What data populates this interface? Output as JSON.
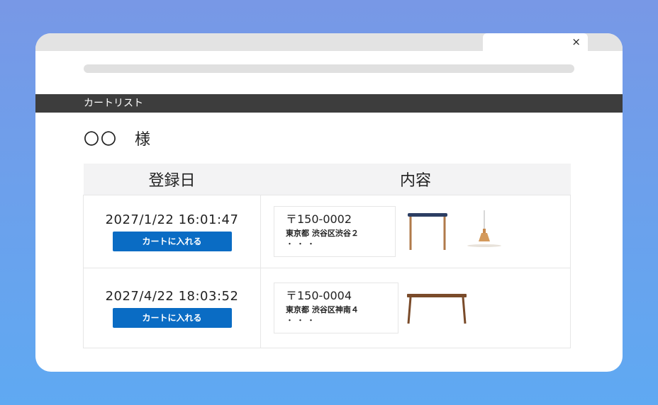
{
  "browser": {
    "tab_close": "×"
  },
  "page": {
    "section_title": "カートリスト",
    "customer_name": "〇〇　様"
  },
  "table": {
    "headers": [
      "登録日",
      "内容"
    ],
    "rows": [
      {
        "date": "2027/1/22 16:01:47",
        "button_label": "カートに入れる",
        "zip": "〒150-0002",
        "address": "東京都 渋谷区渋谷２",
        "ellipsis": "・・・",
        "products": [
          "stool-icon",
          "pendant-lamp-icon"
        ]
      },
      {
        "date": "2027/4/22 18:03:52",
        "button_label": "カートに入れる",
        "zip": "〒150-0004",
        "address": "東京都 渋谷区神南４",
        "ellipsis": "・・・",
        "products": [
          "wooden-table-icon"
        ]
      }
    ]
  },
  "colors": {
    "background_top": "#7898e6",
    "background_bottom": "#5fa9f2",
    "header_bar": "#3d3d3d",
    "button": "#0a6cc4"
  }
}
